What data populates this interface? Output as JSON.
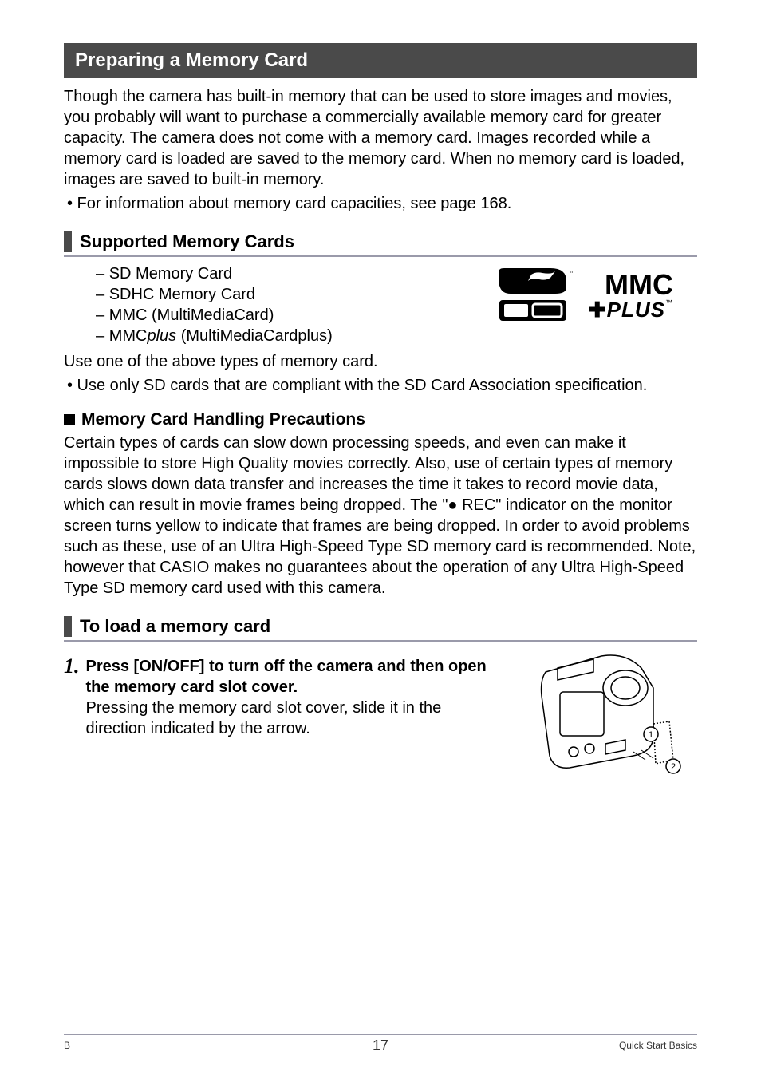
{
  "section_title": "Preparing a Memory Card",
  "intro_text": "Though the camera has built-in memory that can be used to store images and movies, you probably will want to purchase a commercially available memory card for greater capacity. The camera does not come with a memory card. Images recorded while a memory card is loaded are saved to the memory card. When no memory card is loaded, images are saved to built-in memory.",
  "intro_bullet": "• For information about memory card capacities, see page 168.",
  "supported_heading": "Supported Memory Cards",
  "card_items": {
    "0": "SD Memory Card",
    "1": "SDHC Memory Card",
    "2": "MMC (MultiMediaCard)",
    "3_prefix": "MMC",
    "3_italic": "plus",
    "3_suffix": " (MultiMediaCardplus)"
  },
  "logos": {
    "mmc_top": "MMC",
    "mmc_bottom": "PLUS"
  },
  "supported_note1": "Use one of the above types of memory card.",
  "supported_note2": "• Use only SD cards that are compliant with the SD Card Association specification.",
  "handling_heading": "Memory Card Handling Precautions",
  "handling_text": "Certain types of cards can slow down processing speeds, and even can make it impossible to store High Quality movies correctly. Also, use of certain types of memory cards slows down data transfer and increases the time it takes to record movie data, which can result in movie frames being dropped. The \"● REC\" indicator on the monitor screen turns yellow to indicate that frames are being dropped. In order to avoid problems such as these, use of an Ultra High-Speed Type SD memory card is recommended. Note, however that CASIO makes no guarantees about the operation of any Ultra High-Speed Type SD memory card used with this camera.",
  "load_heading": "To load a memory card",
  "step1": {
    "num": "1.",
    "title": "Press [ON/OFF] to turn off the camera and then open the memory card slot cover.",
    "body": "Pressing the memory card slot cover, slide it in the direction indicated by the arrow."
  },
  "footer": {
    "left": "B",
    "center": "17",
    "right": "Quick Start Basics"
  }
}
